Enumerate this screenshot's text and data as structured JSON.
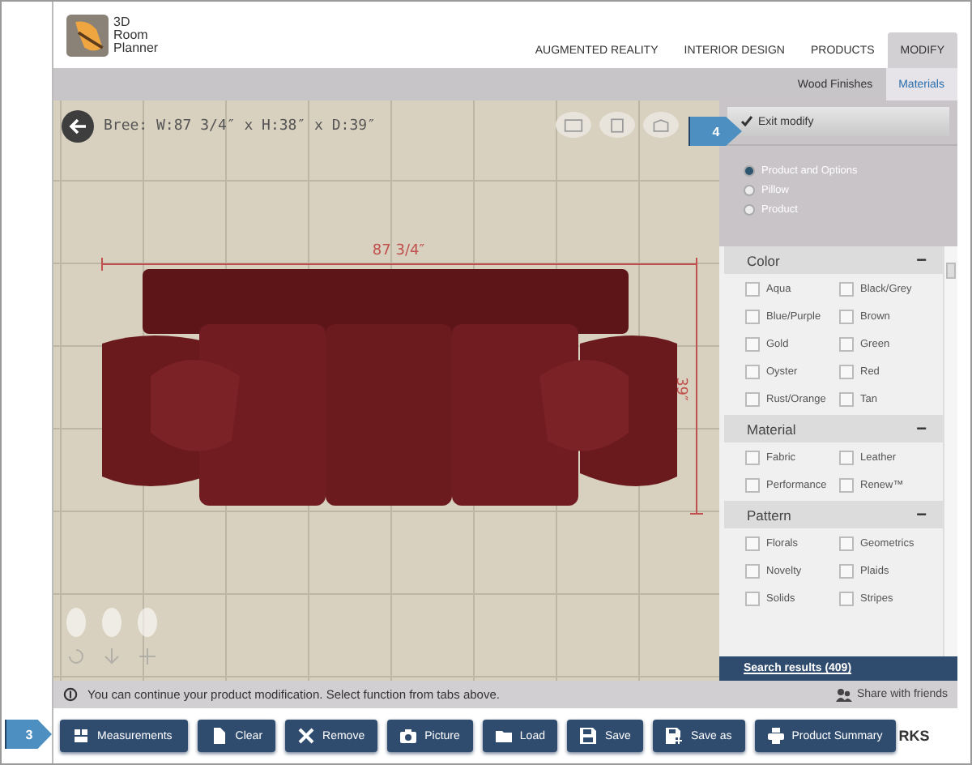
{
  "logo": {
    "lines": [
      "3D",
      "Room",
      "Planner"
    ]
  },
  "nav_tabs": [
    {
      "label": "AUGMENTED REALITY",
      "selected": false
    },
    {
      "label": "INTERIOR DESIGN",
      "selected": false
    },
    {
      "label": "PRODUCTS",
      "selected": false
    },
    {
      "label": "MODIFY",
      "selected": true
    }
  ],
  "sub_tabs": [
    {
      "label": "Wood Finishes",
      "selected": false
    },
    {
      "label": "Materials",
      "selected": true
    }
  ],
  "canvas": {
    "title": "Bree: W:87 3/4″ x H:38″ x D:39″",
    "width_label": "87 3/4″",
    "depth_label": "39″"
  },
  "exit_button": {
    "label": "Exit modify",
    "callout": "4"
  },
  "options": [
    {
      "label": "Product and Options",
      "selected": true
    },
    {
      "label": "Pillow",
      "selected": false
    },
    {
      "label": "Product",
      "selected": false
    }
  ],
  "filters": [
    {
      "title": "Color",
      "collapse": "−",
      "items": [
        {
          "label": "Aqua",
          "checked": false
        },
        {
          "label": "Black/Grey",
          "checked": false
        },
        {
          "label": "Blue/Purple",
          "checked": false
        },
        {
          "label": "Brown",
          "checked": false
        },
        {
          "label": "Gold",
          "checked": false
        },
        {
          "label": "Green",
          "checked": false
        },
        {
          "label": "Oyster",
          "checked": false
        },
        {
          "label": "Red",
          "checked": false
        },
        {
          "label": "Rust/Orange",
          "checked": false
        },
        {
          "label": "Tan",
          "checked": false
        }
      ]
    },
    {
      "title": "Material",
      "collapse": "−",
      "items": [
        {
          "label": "Fabric",
          "checked": false
        },
        {
          "label": "Leather",
          "checked": false
        },
        {
          "label": "Performance",
          "checked": false
        },
        {
          "label": "Renew™",
          "checked": false
        }
      ]
    },
    {
      "title": "Pattern",
      "collapse": "−",
      "items": [
        {
          "label": "Florals",
          "checked": false
        },
        {
          "label": "Geometrics",
          "checked": false
        },
        {
          "label": "Novelty",
          "checked": false
        },
        {
          "label": "Plaids",
          "checked": false
        },
        {
          "label": "Solids",
          "checked": false
        },
        {
          "label": "Stripes",
          "checked": false
        }
      ]
    }
  ],
  "search_results": "Search results (409)",
  "status_message": "You can continue your product modification. Select function from tabs above.",
  "share": "Share with friends",
  "buttons_callout": "3",
  "buttons": [
    {
      "label": "Measurements",
      "kind": "measure"
    },
    {
      "label": "Clear",
      "kind": "file"
    },
    {
      "label": "Remove",
      "kind": "remove"
    },
    {
      "label": "Picture",
      "kind": "camera"
    },
    {
      "label": "Load",
      "kind": "folder"
    },
    {
      "label": "Save",
      "kind": "save"
    },
    {
      "label": "Save as",
      "kind": "saveas"
    },
    {
      "label": "Product Summary",
      "kind": "print"
    }
  ],
  "brand_fragment": "RKS"
}
